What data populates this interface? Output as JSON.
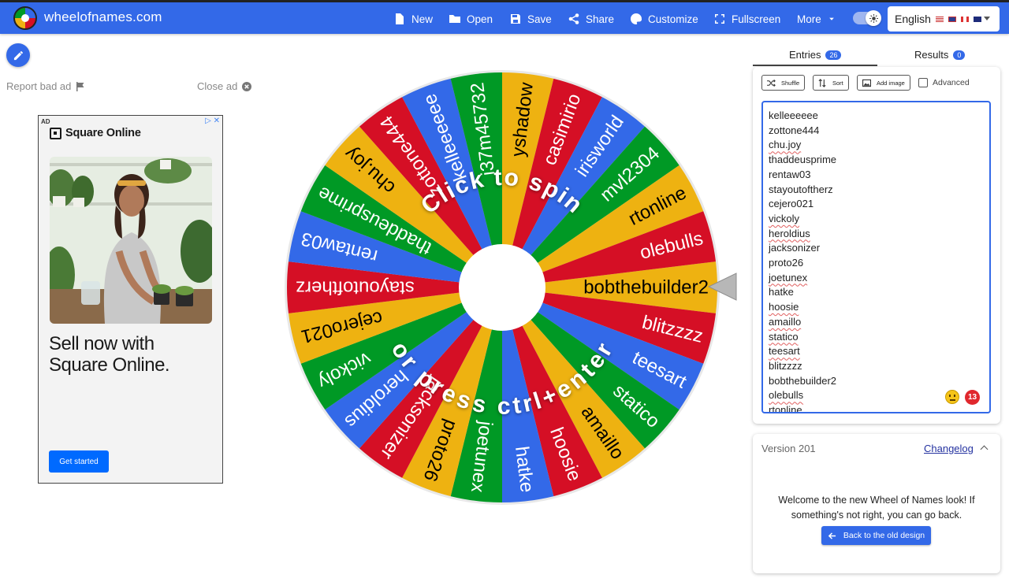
{
  "header": {
    "brand": "wheelofnames.com",
    "nav": [
      {
        "label": "New",
        "icon": "file-icon"
      },
      {
        "label": "Open",
        "icon": "folder-open-icon"
      },
      {
        "label": "Save",
        "icon": "floppy-disk-icon"
      },
      {
        "label": "Share",
        "icon": "share-icon"
      },
      {
        "label": "Customize",
        "icon": "palette-icon"
      },
      {
        "label": "Fullscreen",
        "icon": "fullscreen-icon"
      },
      {
        "label": "More",
        "icon": "chevron-down-icon"
      }
    ],
    "language": "English",
    "colors": {
      "bar": "#3369e8"
    }
  },
  "ad": {
    "report_label": "Report bad ad",
    "close_label": "Close ad",
    "tag": "AD",
    "brand": "Square Online",
    "headline": "Sell now with Square Online.",
    "cta": "Get started"
  },
  "wheel": {
    "center_text_top": "Click to spin",
    "center_text_bottom": "or press ctrl+enter",
    "slice_colors": [
      "#eeb211",
      "#d50f25",
      "#3369e8",
      "#009925"
    ],
    "slices": [
      "bobthebuilder2",
      "blitzzzz",
      "teesart",
      "statico",
      "amaillo",
      "hoosie",
      "hatke",
      "joetunex",
      "proto26",
      "jacksonizer",
      "heroldius",
      "vickoly",
      "cejero021",
      "stayoutoftherz",
      "rentaw03",
      "thaddeusprime",
      "chu.joy",
      "zottone444",
      "kelleeeeee",
      "i37m45732",
      "yshadow",
      "casimirio",
      "irisworld",
      "mvl2304",
      "rtonline",
      "olebulls"
    ]
  },
  "sidebar": {
    "tabs": [
      {
        "label": "Entries",
        "count": "26"
      },
      {
        "label": "Results",
        "count": "0"
      }
    ],
    "toolbar": {
      "shuffle": "Shuffle",
      "sort": "Sort",
      "add_image": "Add image",
      "advanced": "Advanced"
    },
    "entries": [
      {
        "text": "kelleeeeee",
        "flag": false
      },
      {
        "text": "zottone444",
        "flag": false
      },
      {
        "text": "chu.joy",
        "flag": true
      },
      {
        "text": "thaddeusprime",
        "flag": false
      },
      {
        "text": "rentaw03",
        "flag": false
      },
      {
        "text": "stayoutoftherz",
        "flag": false
      },
      {
        "text": "cejero021",
        "flag": false
      },
      {
        "text": "vickoly",
        "flag": true
      },
      {
        "text": "heroldius",
        "flag": true
      },
      {
        "text": "jacksonizer",
        "flag": false
      },
      {
        "text": "proto26",
        "flag": false
      },
      {
        "text": "joetunex",
        "flag": true
      },
      {
        "text": "hatke",
        "flag": false
      },
      {
        "text": "hoosie",
        "flag": true
      },
      {
        "text": "amaillo",
        "flag": true
      },
      {
        "text": "statico",
        "flag": true
      },
      {
        "text": "teesart",
        "flag": true
      },
      {
        "text": "blitzzzz",
        "flag": false
      },
      {
        "text": "bobthebuilder2",
        "flag": false
      },
      {
        "text": "olebulls",
        "flag": true
      },
      {
        "text": "rtonline",
        "flag": false
      }
    ],
    "issue_count": "13"
  },
  "version": {
    "title": "Version 201",
    "changelog": "Changelog",
    "welcome": "Welcome to the new Wheel of Names look! If something's not right, you can go back.",
    "back_button": "Back to the old design"
  }
}
